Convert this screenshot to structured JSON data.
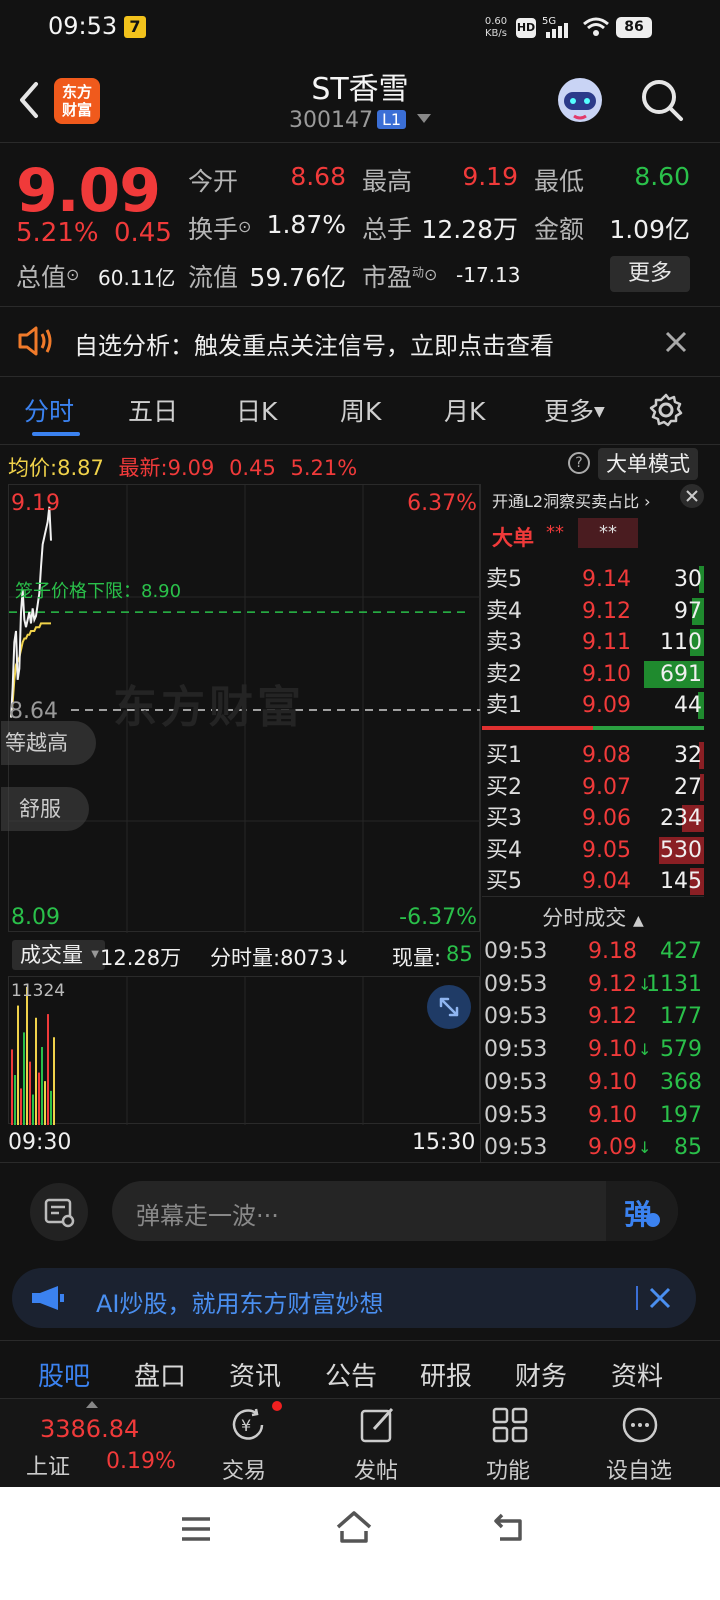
{
  "status": {
    "time": "09:53",
    "net_speed": "0.60 KB/s",
    "battery": "86"
  },
  "header": {
    "name": "ST香雪",
    "code": "300147",
    "level_badge": "L1",
    "logo_text_1": "东方",
    "logo_text_2": "财富"
  },
  "quote": {
    "price": "9.09",
    "pct": "5.21%",
    "change": "0.45",
    "open_label": "今开",
    "open": "8.68",
    "high_label": "最高",
    "high": "9.19",
    "low_label": "最低",
    "low": "8.60",
    "turnover_label": "换手",
    "turnover": "1.87%",
    "volume_label": "总手",
    "volume": "12.28万",
    "amount_label": "金额",
    "amount": "1.09亿",
    "mcap_label": "总值",
    "mcap": "60.11亿",
    "float_label": "流值",
    "float": "59.76亿",
    "pe_label": "市盈",
    "pe_sup": "动",
    "pe": "-17.13",
    "more_label": "更多"
  },
  "notice": {
    "text": "自选分析：触发重点关注信号，立即点击查看"
  },
  "tabs": [
    "分时",
    "五日",
    "日K",
    "周K",
    "月K",
    "更多"
  ],
  "chart_header": {
    "avg_label": "均价:",
    "avg": "8.87",
    "latest_label": "最新:",
    "latest": "9.09",
    "chg": "0.45",
    "pct": "5.21%",
    "mode_label": "大单模式"
  },
  "chart_data": {
    "type": "line",
    "price_top": "9.19",
    "price_bottom": "8.09",
    "pct_top": "6.37%",
    "pct_bottom": "-6.37%",
    "prev_close": "8.64",
    "cage_label": "笼子价格下限：8.90",
    "watermark": "东方财富",
    "time_start": "09:30",
    "time_end": "15:30",
    "ylim": [
      8.09,
      9.19
    ],
    "price_series": [
      8.62,
      8.7,
      8.82,
      8.85,
      8.72,
      8.75,
      8.9,
      8.96,
      8.88,
      8.86,
      8.88,
      8.9,
      8.87,
      8.91,
      8.88,
      8.89,
      8.92,
      8.95,
      9.02,
      9.08,
      9.1,
      9.12,
      9.14,
      9.18,
      9.09
    ],
    "avg_series": [
      8.62,
      8.66,
      8.72,
      8.76,
      8.77,
      8.78,
      8.8,
      8.82,
      8.83,
      8.83,
      8.84,
      8.84,
      8.85,
      8.85,
      8.85,
      8.86,
      8.86,
      8.86,
      8.87,
      8.87,
      8.87,
      8.87,
      8.87,
      8.87,
      8.87
    ],
    "volume_max": "11324",
    "volume_series": [
      6200,
      4100,
      9800,
      3000,
      7600,
      11324,
      5200,
      2500,
      8800,
      4300,
      6400,
      3600,
      9100,
      2800,
      7200
    ]
  },
  "volume_bar": {
    "label": "成交量",
    "total": "12.28万",
    "minute_label": "分时量:8073↓",
    "now_label": "现量:",
    "now": "85"
  },
  "tags": [
    "等越高",
    "舒服"
  ],
  "orderbook": {
    "promo": "开通L2洞察买卖占比 ›",
    "big_label": "大单",
    "stars1": "**",
    "stars2": "**",
    "asks": [
      {
        "label": "卖5",
        "price": "9.14",
        "qty": "30",
        "bar": 0.05
      },
      {
        "label": "卖4",
        "price": "9.12",
        "qty": "97",
        "bar": 0.12
      },
      {
        "label": "卖3",
        "price": "9.11",
        "qty": "110",
        "bar": 0.14
      },
      {
        "label": "卖2",
        "price": "9.10",
        "qty": "691",
        "bar": 0.6
      },
      {
        "label": "卖1",
        "price": "9.09",
        "qty": "44",
        "bar": 0.06
      }
    ],
    "bids": [
      {
        "label": "买1",
        "price": "9.08",
        "qty": "32",
        "bar": 0.05
      },
      {
        "label": "买2",
        "price": "9.07",
        "qty": "27",
        "bar": 0.04
      },
      {
        "label": "买3",
        "price": "9.06",
        "qty": "234",
        "bar": 0.22
      },
      {
        "label": "买4",
        "price": "9.05",
        "qty": "530",
        "bar": 0.45
      },
      {
        "label": "买5",
        "price": "9.04",
        "qty": "145",
        "bar": 0.14
      }
    ],
    "trades_title": "分时成交",
    "trades": [
      {
        "time": "09:53",
        "price": "9.18",
        "qty": "427",
        "arrow": ""
      },
      {
        "time": "09:53",
        "price": "9.12",
        "qty": "1131",
        "arrow": "↓"
      },
      {
        "time": "09:53",
        "price": "9.12",
        "qty": "177",
        "arrow": ""
      },
      {
        "time": "09:53",
        "price": "9.10",
        "qty": "579",
        "arrow": "↓"
      },
      {
        "time": "09:53",
        "price": "9.10",
        "qty": "368",
        "arrow": ""
      },
      {
        "time": "09:53",
        "price": "9.10",
        "qty": "197",
        "arrow": ""
      },
      {
        "time": "09:53",
        "price": "9.09",
        "qty": "85",
        "arrow": "↓"
      }
    ]
  },
  "danmu": {
    "placeholder": "弹幕走一波···",
    "btn": "弹"
  },
  "ai_bar": {
    "text": "AI炒股，就用东方财富妙想"
  },
  "bottom_tabs": [
    "股吧",
    "盘口",
    "资讯",
    "公告",
    "研报",
    "财务",
    "资料"
  ],
  "bottom_bar": {
    "index_value": "3386.84",
    "index_name": "上证",
    "index_pct": "0.19%",
    "trade": "交易",
    "post": "发帖",
    "func": "功能",
    "watch": "设自选"
  },
  "colors": {
    "up": "#f03a3a",
    "down": "#2ac04a",
    "accent": "#3b82f0",
    "avg_line": "#f0d24a"
  }
}
